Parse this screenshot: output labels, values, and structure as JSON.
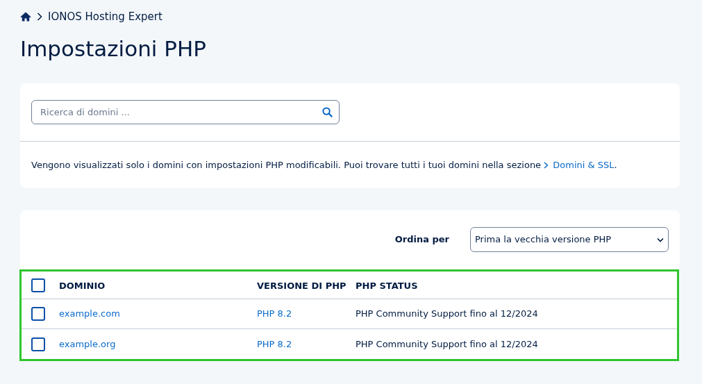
{
  "breadcrumb": {
    "items": [
      "IONOS Hosting Expert"
    ]
  },
  "title": "Impostazioni PHP",
  "search": {
    "placeholder": "Ricerca di domini ..."
  },
  "notice": {
    "text": "Vengono visualizzati solo i domini con impostazioni PHP modificabili. Puoi trovare tutti i tuoi domini nella sezione",
    "link": "Domini & SSL",
    "suffix": "."
  },
  "sort": {
    "label": "Ordina per",
    "value": "Prima la vecchia versione PHP"
  },
  "table": {
    "highlighted": true,
    "select_all": {
      "checked": false
    },
    "columns": [
      "DOMINIO",
      "VERSIONE DI PHP",
      "PHP STATUS"
    ],
    "rows": [
      {
        "checked": false,
        "domain": "example.com",
        "version": "PHP 8.2",
        "status": "PHP Community Support fino al 12/2024"
      },
      {
        "checked": false,
        "domain": "example.org",
        "version": "PHP 8.2",
        "status": "PHP Community Support fino al 12/2024"
      }
    ]
  }
}
